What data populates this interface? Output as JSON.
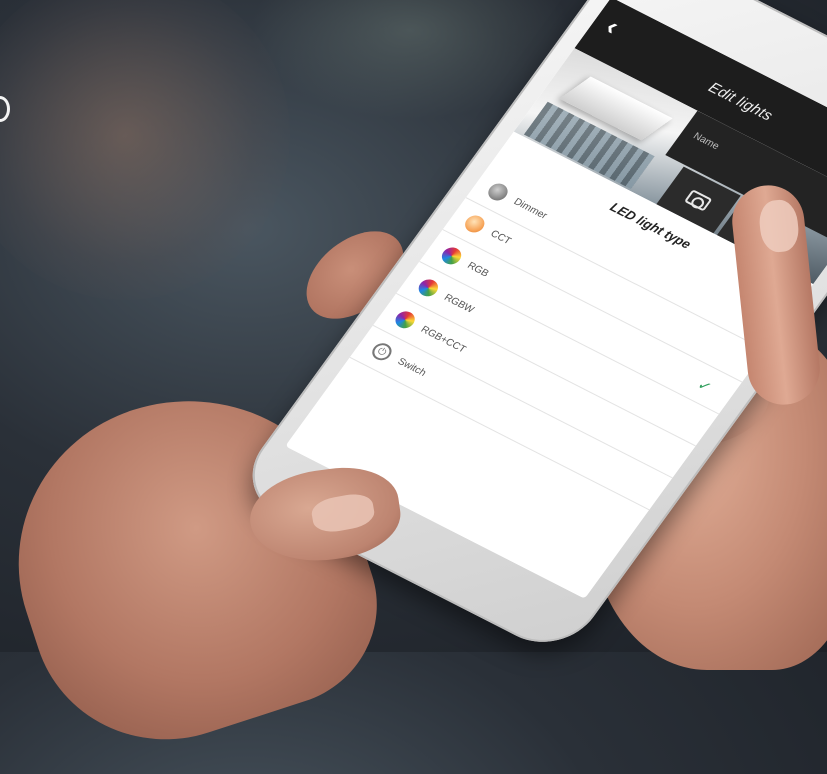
{
  "header": {
    "back_symbol": "‹",
    "title": "Edit lights"
  },
  "name_field": {
    "label": "Name"
  },
  "sheet": {
    "title": "LED light type",
    "items": [
      {
        "label": "Dimmer",
        "icon": "dimmer-icon",
        "selected": false
      },
      {
        "label": "CCT",
        "icon": "cct-icon",
        "selected": false
      },
      {
        "label": "RGB",
        "icon": "rgb-icon",
        "selected": true
      },
      {
        "label": "RGBW",
        "icon": "rgbw-icon",
        "selected": false
      },
      {
        "label": "RGB+CCT",
        "icon": "rgb-cct-icon",
        "selected": false
      },
      {
        "label": "Switch",
        "icon": "switch-icon",
        "selected": false
      }
    ],
    "check_symbol": "✓"
  },
  "colors": {
    "topbar": "#1d1d1d",
    "check": "#2e9e5b"
  }
}
